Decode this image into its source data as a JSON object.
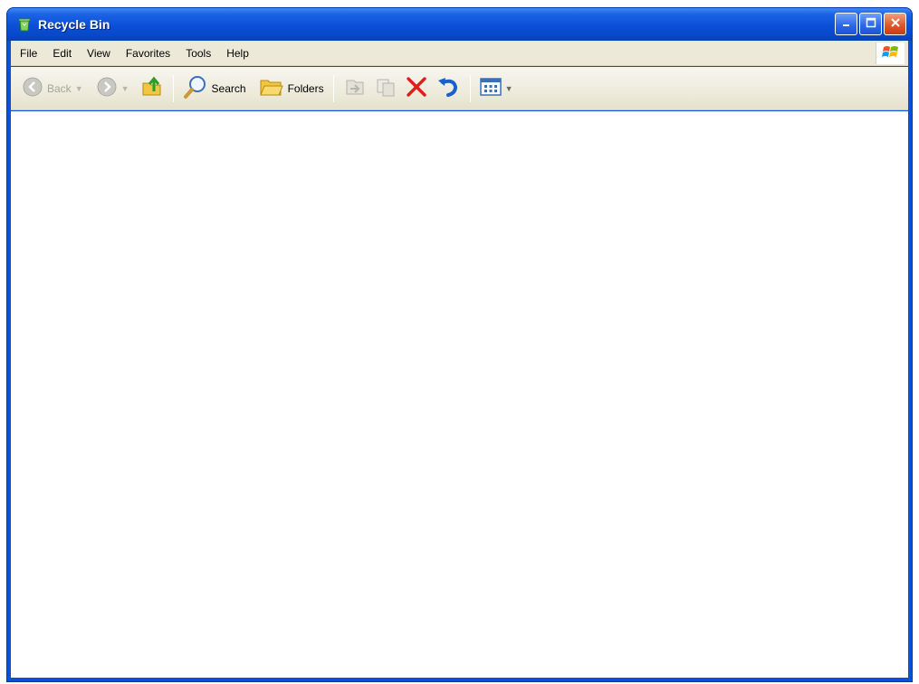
{
  "window": {
    "title": "Recycle Bin"
  },
  "menubar": {
    "items": [
      {
        "label": "File"
      },
      {
        "label": "Edit"
      },
      {
        "label": "View"
      },
      {
        "label": "Favorites"
      },
      {
        "label": "Tools"
      },
      {
        "label": "Help"
      }
    ]
  },
  "toolbar": {
    "back_label": "Back",
    "search_label": "Search",
    "folders_label": "Folders"
  },
  "icons": {
    "title": "recycle-bin-icon",
    "minimize": "minimize-icon",
    "maximize": "maximize-icon",
    "close": "close-icon",
    "back": "back-arrow-icon",
    "forward": "forward-arrow-icon",
    "up": "folder-up-icon",
    "search": "magnifier-icon",
    "folders": "folders-icon",
    "move_to": "move-to-icon",
    "copy_to": "copy-to-icon",
    "delete": "delete-x-icon",
    "undo": "undo-icon",
    "views": "views-icon"
  },
  "colors": {
    "titlebar": "#0a4fd6",
    "chrome": "#ece9d8",
    "close_button": "#e0582c",
    "delete_icon": "#e21b1b",
    "undo_icon": "#1a5fd0"
  }
}
